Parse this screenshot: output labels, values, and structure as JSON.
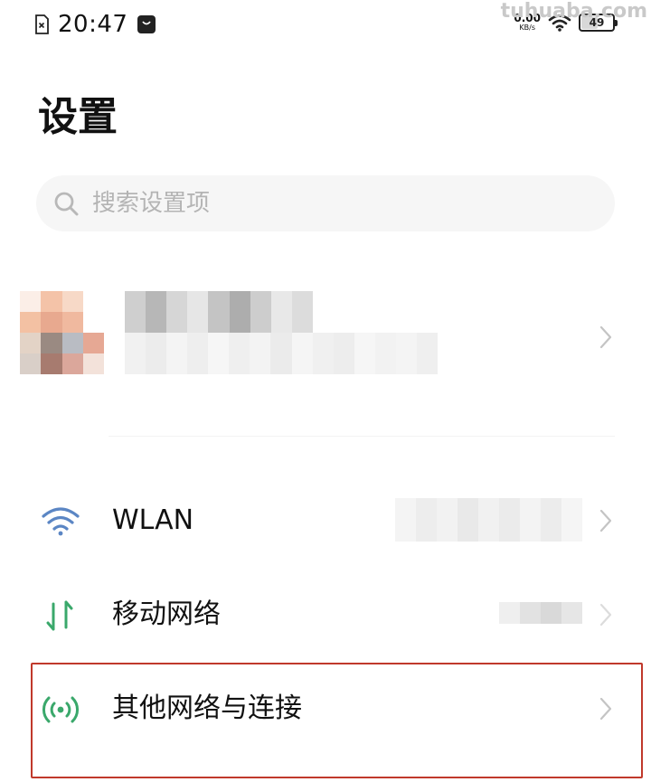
{
  "status_bar": {
    "time": "20:47",
    "net_speed_value": "0.00",
    "net_speed_unit": "KB/s",
    "battery_level": "49",
    "battery_fraction": 0.49,
    "watermark": "tuhuaba.com"
  },
  "page": {
    "title": "设置"
  },
  "search": {
    "placeholder": "搜索设置项",
    "value": ""
  },
  "settings": [
    {
      "label": "WLAN",
      "icon": "wifi-icon"
    },
    {
      "label": "移动网络",
      "icon": "mobile-data-icon"
    },
    {
      "label": "其他网络与连接",
      "icon": "hotspot-icon"
    }
  ],
  "colors": {
    "wifi_icon": "#5b86c4",
    "mobile_icon": "#3aa86b",
    "other_network_icon": "#3aa86b",
    "highlight_border": "#c0392b",
    "search_bg": "#f6f6f6"
  }
}
